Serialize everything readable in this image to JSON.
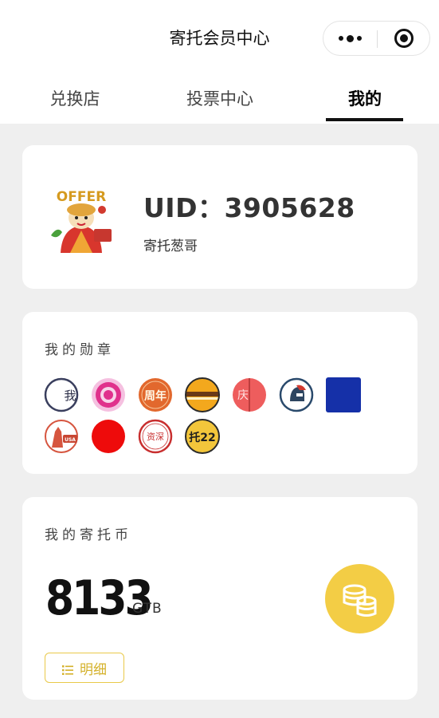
{
  "header": {
    "title": "寄托会员中心"
  },
  "tabs": [
    {
      "label": "兑换店",
      "active": false
    },
    {
      "label": "投票中心",
      "active": false
    },
    {
      "label": "我的",
      "active": true
    }
  ],
  "profile": {
    "uid": "UID：3905628",
    "nickname": "寄托葱哥",
    "avatar_text": "OFFER"
  },
  "medals": {
    "title": "我的勋章",
    "items": [
      {
        "name": "medal-wo",
        "text": "我"
      },
      {
        "name": "medal-flower",
        "text": ""
      },
      {
        "name": "medal-zhounian",
        "text": "周年"
      },
      {
        "name": "medal-stripe",
        "text": ""
      },
      {
        "name": "medal-qing",
        "text": "庆"
      },
      {
        "name": "medal-spartan",
        "text": ""
      },
      {
        "name": "medal-blue-square",
        "text": ""
      },
      {
        "name": "medal-usa",
        "text": "USA"
      },
      {
        "name": "medal-red",
        "text": ""
      },
      {
        "name": "medal-zishen",
        "text": "资深"
      },
      {
        "name": "medal-tuo22",
        "text": "托22"
      }
    ]
  },
  "coins": {
    "title": "我的寄托币",
    "amount": "8133",
    "unit": "GTB",
    "detail_label": "明细"
  },
  "colors": {
    "accent_yellow": "#f3cd45",
    "detail_border": "#e9c94a",
    "background": "#efefef"
  }
}
